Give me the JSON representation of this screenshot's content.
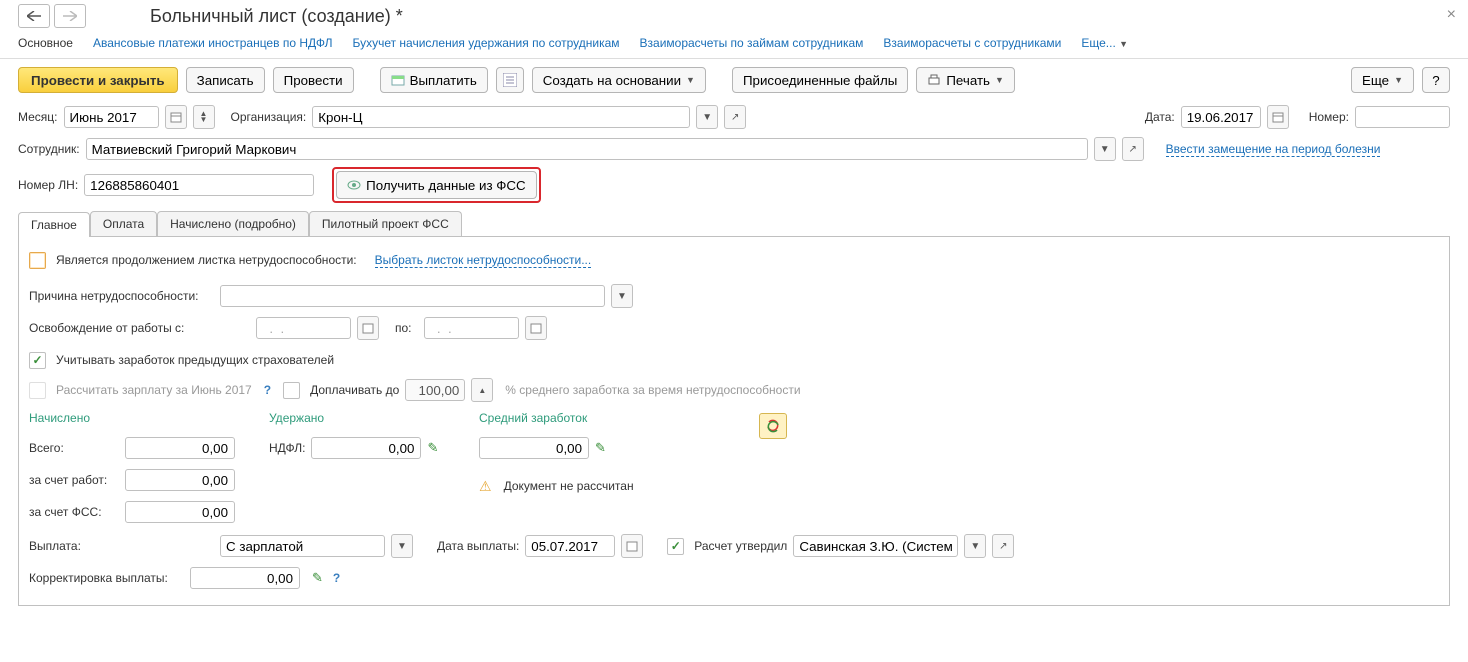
{
  "title": "Больничный лист (создание) *",
  "linkbar": {
    "active": "Основное",
    "links": [
      "Авансовые платежи иностранцев по НДФЛ",
      "Бухучет начисления удержания по сотрудникам",
      "Взаиморасчеты по займам сотрудникам",
      "Взаиморасчеты с сотрудниками"
    ],
    "more": "Еще..."
  },
  "toolbar": {
    "primary": "Провести и закрыть",
    "save": "Записать",
    "post": "Провести",
    "pay": "Выплатить",
    "create_on": "Создать на основании",
    "attached": "Присоединенные файлы",
    "print": "Печать",
    "more": "Еще",
    "help": "?"
  },
  "row_month": {
    "label": "Месяц:",
    "value": "Июнь 2017",
    "org_label": "Организация:",
    "org_value": "Крон-Ц",
    "date_label": "Дата:",
    "date_value": "19.06.2017",
    "num_label": "Номер:",
    "num_value": ""
  },
  "row_emp": {
    "label": "Сотрудник:",
    "value": "Матвиевский Григорий Маркович",
    "link": "Ввести замещение на период болезни"
  },
  "row_ln": {
    "label": "Номер ЛН:",
    "value": "126885860401",
    "fss_btn": "Получить данные из ФСС"
  },
  "tabs": [
    "Главное",
    "Оплата",
    "Начислено (подробно)",
    "Пилотный проект ФСС"
  ],
  "main": {
    "cont_label": "Является продолжением листка нетрудоспособности:",
    "cont_link": "Выбрать листок нетрудоспособности...",
    "reason_label": "Причина нетрудоспособности:",
    "reason_value": "",
    "release_label": "Освобождение от работы с:",
    "release_from": "  .  .    ",
    "release_to_label": "по:",
    "release_to": "  .  .    ",
    "prev_ins_label": "Учитывать заработок предыдущих страхователей",
    "calc_salary_label": "Рассчитать зарплату за Июнь 2017",
    "extra_pay_label": "Доплачивать до",
    "extra_pay_value": "100,00",
    "extra_pay_note": "% среднего заработка за время нетрудоспособности"
  },
  "sums": {
    "accrued_title": "Начислено",
    "deducted_title": "Удержано",
    "avg_title": "Средний заработок",
    "total_label": "Всего:",
    "emp_label": "за счет работ:",
    "fss_label": "за счет ФСС:",
    "ndfl_label": "НДФЛ:",
    "total_val": "0,00",
    "emp_val": "0,00",
    "fss_val": "0,00",
    "ndfl_val": "0,00",
    "avg_val": "0,00",
    "not_calc": "Документ не рассчитан"
  },
  "pay": {
    "label": "Выплата:",
    "value": "С зарплатой",
    "date_label": "Дата выплаты:",
    "date_value": "05.07.2017",
    "approved_label": "Расчет утвердил",
    "approved_value": "Савинская З.Ю. (Системны",
    "corr_label": "Корректировка выплаты:",
    "corr_value": "0,00"
  }
}
